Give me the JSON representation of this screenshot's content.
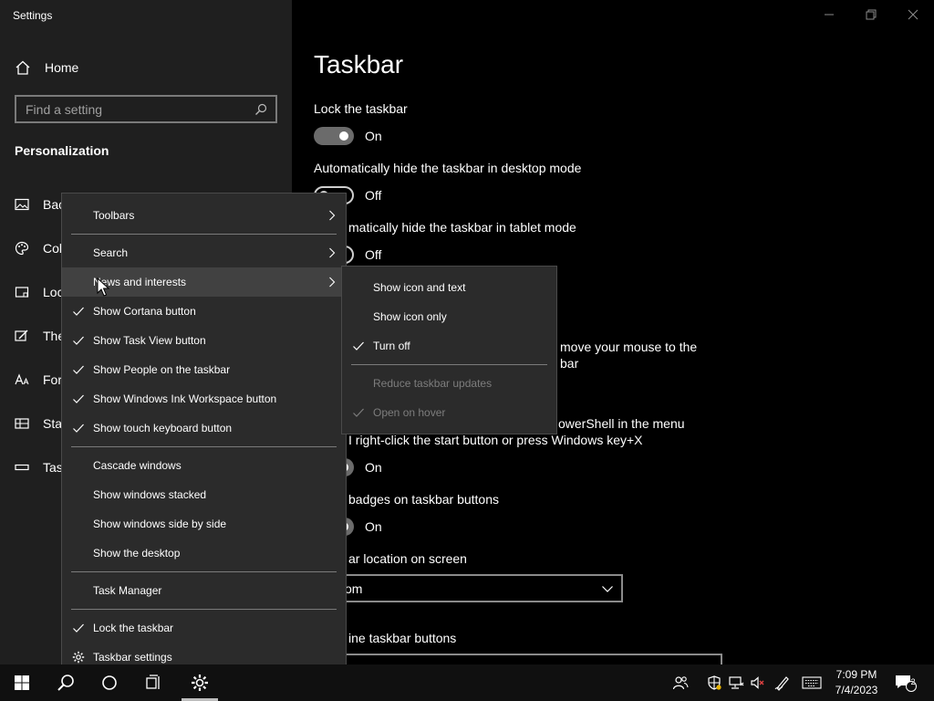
{
  "window": {
    "app_title": "Settings",
    "controls": [
      "minimize-icon",
      "restore-icon",
      "close-icon"
    ]
  },
  "sidebar": {
    "home_label": "Home",
    "search_placeholder": "Find a setting",
    "section_title": "Personalization",
    "items": [
      {
        "label": "Bac",
        "icon": "image-icon"
      },
      {
        "label": "Col",
        "icon": "palette-icon"
      },
      {
        "label": "Loc",
        "icon": "lock-screen-icon"
      },
      {
        "label": "The",
        "icon": "themes-brush-icon"
      },
      {
        "label": "For",
        "icon": "fonts-icon"
      },
      {
        "label": "Sta",
        "icon": "start-grid-icon"
      },
      {
        "label": "Tas",
        "icon": "taskbar-icon"
      }
    ]
  },
  "main": {
    "title": "Taskbar",
    "settings": [
      {
        "label": "Lock the taskbar",
        "state": "On"
      },
      {
        "label": "Automatically hide the taskbar in desktop mode",
        "state": "Off"
      },
      {
        "label": "matically hide the taskbar in tablet mode",
        "state": "Off"
      },
      {
        "label_line1": "move your mouse to the",
        "label_line2": "bar"
      },
      {
        "label_line1": "owerShell in the menu",
        "label_line2": "I right-click the start button or press Windows key+X",
        "state": "On"
      },
      {
        "label": "badges on taskbar buttons",
        "state": "On"
      }
    ],
    "location_label": "ar location on screen",
    "location_value": "om",
    "combine_label": "ine taskbar buttons"
  },
  "context_menu": {
    "items": [
      {
        "label": "Toolbars",
        "submenu": true,
        "checked": false
      },
      {
        "label": "Search",
        "submenu": true,
        "checked": false
      },
      {
        "label": "News and interests",
        "submenu": true,
        "checked": false
      },
      {
        "label": "Show Cortana button",
        "checked": true
      },
      {
        "label": "Show Task View button",
        "checked": true
      },
      {
        "label": "Show People on the taskbar",
        "checked": true
      },
      {
        "label": "Show Windows Ink Workspace button",
        "checked": true
      },
      {
        "label": "Show touch keyboard button",
        "checked": true
      },
      {
        "label": "Cascade windows",
        "checked": false
      },
      {
        "label": "Show windows stacked",
        "checked": false
      },
      {
        "label": "Show windows side by side",
        "checked": false
      },
      {
        "label": "Show the desktop",
        "checked": false
      },
      {
        "label": "Task Manager",
        "checked": false
      },
      {
        "label": "Lock the taskbar",
        "checked": true
      },
      {
        "label": "Taskbar settings",
        "icon": "gear-icon"
      }
    ]
  },
  "submenu": {
    "items": [
      {
        "label": "Show icon and text",
        "checked": false,
        "disabled": false
      },
      {
        "label": "Show icon only",
        "checked": false,
        "disabled": false
      },
      {
        "label": "Turn off",
        "checked": true,
        "disabled": false
      },
      {
        "label": "Reduce taskbar updates",
        "checked": false,
        "disabled": true
      },
      {
        "label": "Open on hover",
        "checked": true,
        "disabled": true
      }
    ]
  },
  "taskbar": {
    "clock_time": "7:09 PM",
    "clock_date": "7/4/2023",
    "notification_count": "2",
    "icons": [
      "windows-start-icon",
      "search-icon",
      "cortana-icon",
      "task-view-icon",
      "settings-gear-icon",
      "people-icon",
      "defender-icon",
      "network-icon",
      "volume-muted-icon",
      "pen-icon",
      "keyboard-icon",
      "action-center-icon"
    ]
  }
}
